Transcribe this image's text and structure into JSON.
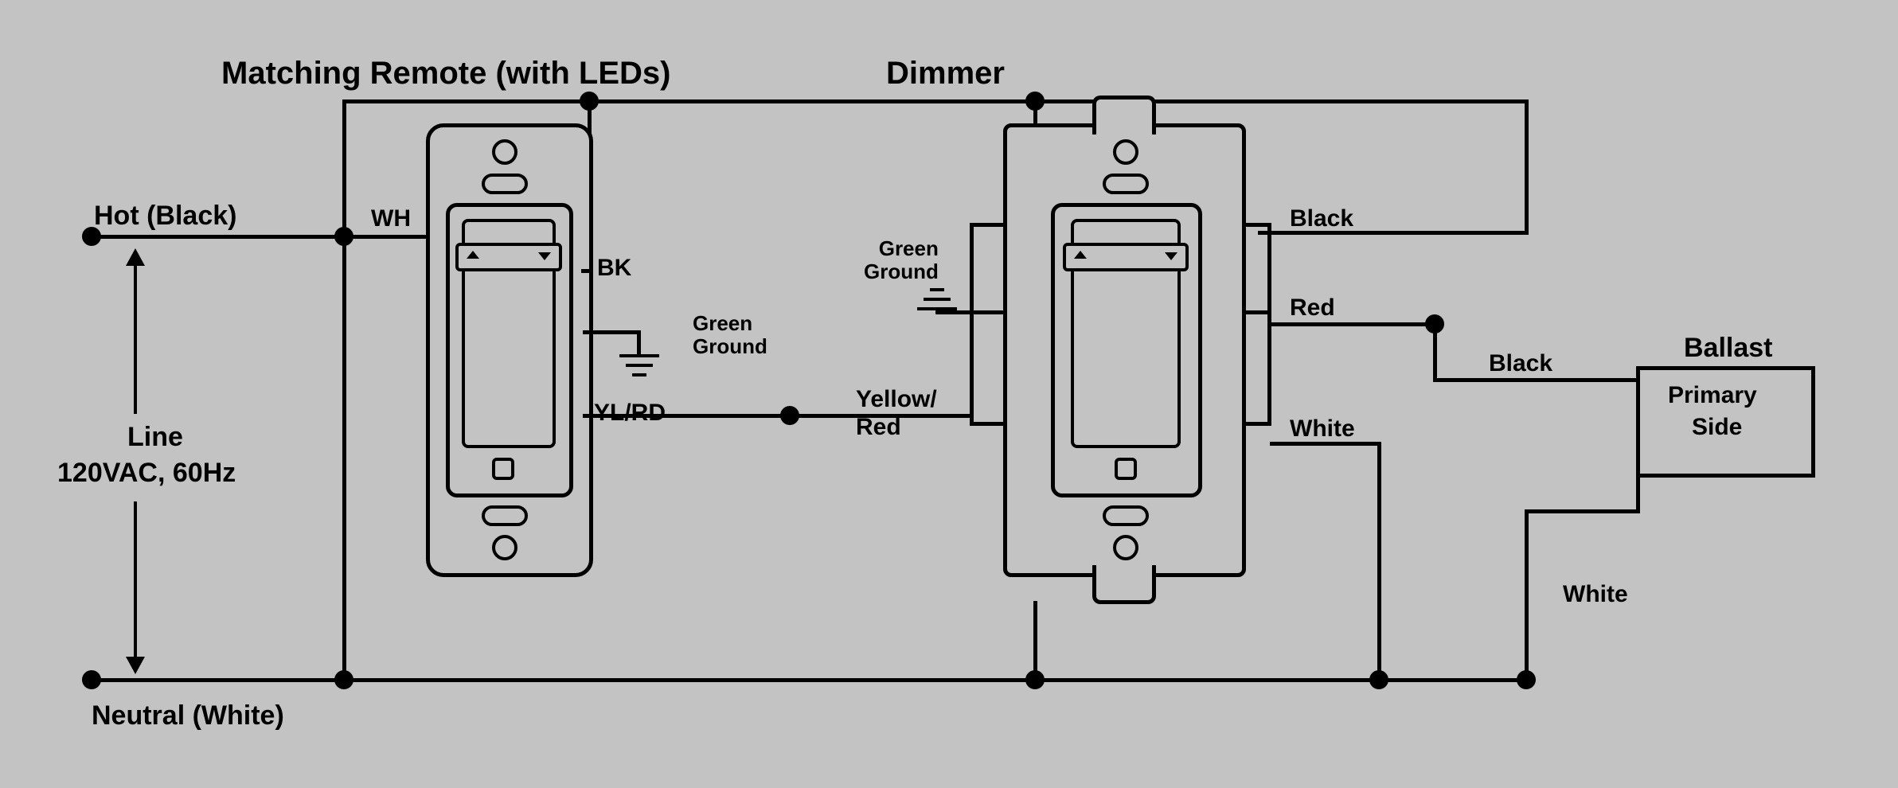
{
  "titles": {
    "remote": "Matching Remote (with LEDs)",
    "dimmer": "Dimmer"
  },
  "source": {
    "hot": "Hot (Black)",
    "neutral": "Neutral (White)",
    "line1": "Line",
    "line2": "120VAC, 60Hz"
  },
  "remote_wires": {
    "wh": "WH",
    "bk": "BK",
    "ylrd": "YL/RD",
    "ground": "Green\nGround"
  },
  "dimmer_wires": {
    "ylrd1": "Yellow/",
    "ylrd2": "Red",
    "black": "Black",
    "red": "Red",
    "white": "White",
    "ground": "Green\nGround"
  },
  "to_ballast": {
    "black": "Black",
    "white": "White",
    "title": "Ballast",
    "primary": "Primary",
    "side": "Side"
  }
}
